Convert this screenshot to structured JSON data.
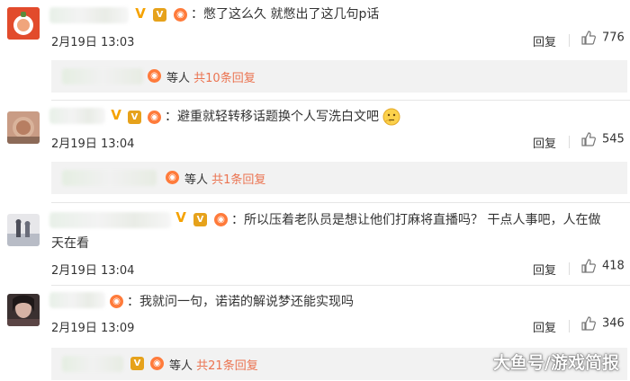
{
  "comments": [
    {
      "text": "：憋了这么久 就憋出了这几句p话",
      "date": "2月19日 13:03",
      "reply_label": "回复",
      "likes": "776",
      "sub": {
        "who": "等人",
        "count_label": "共10条回复"
      }
    },
    {
      "text": "：避重就轻转移话题换个人写洗白文吧",
      "date": "2月19日 13:04",
      "reply_label": "回复",
      "likes": "545",
      "sub": {
        "who": "等人",
        "count_label": "共1条回复"
      }
    },
    {
      "text_line1": "：所以压着老队员是想让他们打麻将直播吗？ 干点人事吧，人在做",
      "text_line2": "天在看",
      "date": "2月19日 13:04",
      "reply_label": "回复",
      "likes": "418"
    },
    {
      "text": "：我就问一句，诺诺的解说梦还能实现吗",
      "date": "2月19日 13:09",
      "reply_label": "回复",
      "likes": "346",
      "sub": {
        "who": "等人",
        "count_label": "共21条回复"
      }
    }
  ],
  "watermark": "大鱼号/游戏简报",
  "colors": {
    "link": "#eb7350",
    "subbar_bg": "#f2f2f2",
    "badge_vip": "#e6a21b"
  },
  "icons": {
    "like": "thumbs-up-icon",
    "verified": "v-badge-icon",
    "vip": "vip-badge-icon",
    "fire": "fire-badge-icon"
  }
}
